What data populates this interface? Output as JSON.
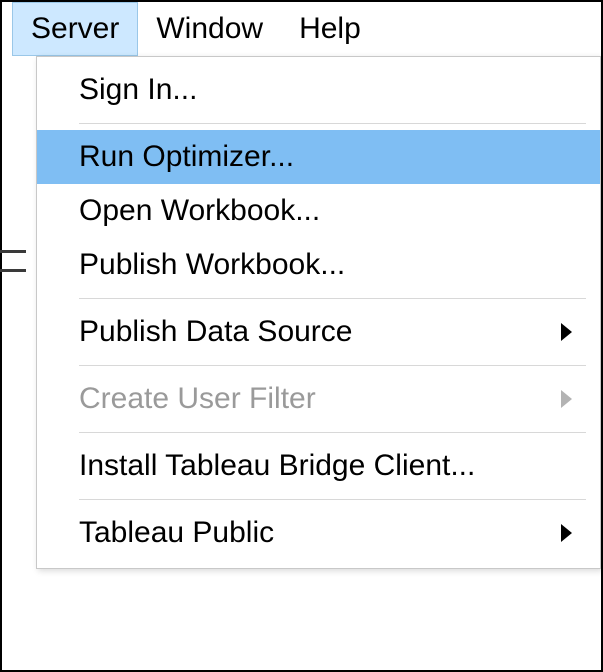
{
  "menubar": {
    "items": [
      {
        "label": "Server",
        "active": true
      },
      {
        "label": "Window",
        "active": false
      },
      {
        "label": "Help",
        "active": false
      }
    ]
  },
  "server_menu": {
    "groups": [
      [
        {
          "label": "Sign In...",
          "submenu": false,
          "disabled": false,
          "highlight": false
        }
      ],
      [
        {
          "label": "Run Optimizer...",
          "submenu": false,
          "disabled": false,
          "highlight": true
        },
        {
          "label": "Open Workbook...",
          "submenu": false,
          "disabled": false,
          "highlight": false
        },
        {
          "label": "Publish Workbook...",
          "submenu": false,
          "disabled": false,
          "highlight": false
        }
      ],
      [
        {
          "label": "Publish Data Source",
          "submenu": true,
          "disabled": false,
          "highlight": false
        }
      ],
      [
        {
          "label": "Create User Filter",
          "submenu": true,
          "disabled": true,
          "highlight": false
        }
      ],
      [
        {
          "label": "Install Tableau Bridge Client...",
          "submenu": false,
          "disabled": false,
          "highlight": false
        }
      ],
      [
        {
          "label": "Tableau Public",
          "submenu": true,
          "disabled": false,
          "highlight": false
        }
      ]
    ]
  }
}
